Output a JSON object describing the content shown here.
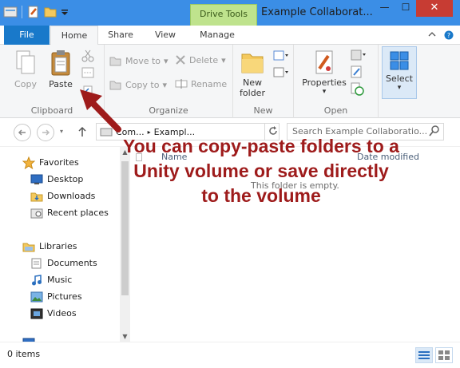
{
  "titlebar": {
    "title": "Example Collaborat...",
    "context_tab": "Drive Tools",
    "buttons": {
      "minimize": "—",
      "maximize": "☐",
      "close": "✕"
    }
  },
  "ribbon_tabs": {
    "file": "File",
    "home": "Home",
    "share": "Share",
    "view": "View",
    "manage": "Manage"
  },
  "ribbon": {
    "clipboard": {
      "label": "Clipboard",
      "copy": "Copy",
      "paste": "Paste"
    },
    "organize": {
      "label": "Organize",
      "move_to": "Move to",
      "copy_to": "Copy to",
      "delete": "Delete",
      "rename": "Rename"
    },
    "new": {
      "label": "New",
      "new_folder_line1": "New",
      "new_folder_line2": "folder"
    },
    "open": {
      "label": "Open",
      "properties": "Properties"
    },
    "select": {
      "label": "Select"
    }
  },
  "address": {
    "crumb1": "Com...",
    "crumb2": "Exampl...",
    "search_placeholder": "Search Example Collaboratio..."
  },
  "nav": {
    "favorites": "Favorites",
    "desktop": "Desktop",
    "downloads": "Downloads",
    "recent": "Recent places",
    "libraries": "Libraries",
    "documents": "Documents",
    "music": "Music",
    "pictures": "Pictures",
    "videos": "Videos"
  },
  "content": {
    "col_name": "Name",
    "col_date": "Date modified",
    "empty": "This folder is empty."
  },
  "status": {
    "items": "0 items"
  },
  "annotation": {
    "line1": "You can copy-paste folders to a",
    "line2": "Unity volume or save directly",
    "line3": "to the volume"
  },
  "colors": {
    "titlebar": "#3b8ee6",
    "file_tab": "#1979ca",
    "annotation": "#9e1b1b",
    "context_tab": "#bfe38d",
    "close": "#c73c33"
  }
}
